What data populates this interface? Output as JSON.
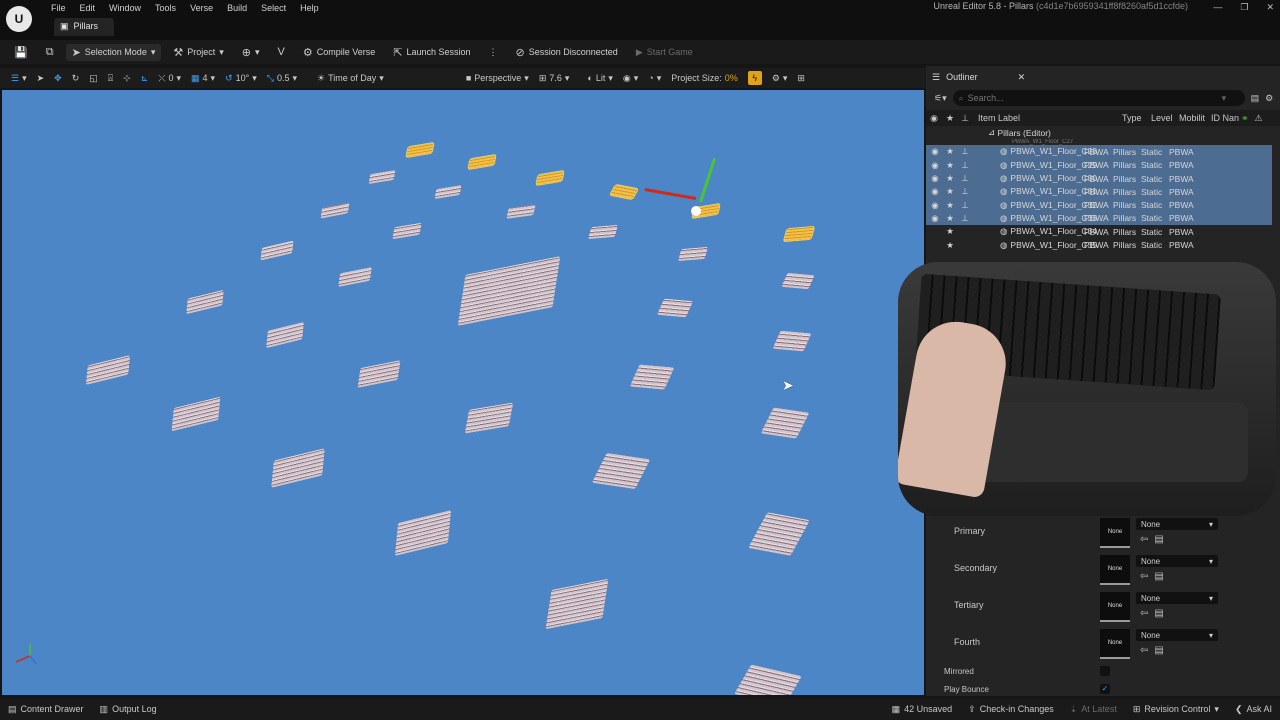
{
  "menu": [
    "File",
    "Edit",
    "Window",
    "Tools",
    "Verse",
    "Build",
    "Select",
    "Help"
  ],
  "level_tab": "Pillars",
  "app_title": "Unreal Editor 5.8 - Pillars",
  "app_hash": "(c4d1e7b6959341ff8f8260af5d1ccfde)",
  "toolbar": {
    "selection_mode": "Selection Mode",
    "project": "Project",
    "compile_verse": "Compile Verse",
    "launch_session": "Launch Session",
    "session_status": "Session Disconnected",
    "start_game": "Start Game"
  },
  "viewport_toolbar": {
    "count_a": "0",
    "count_b": "4",
    "angle_snap": "10°",
    "scale_snap": "0.5",
    "time_of_day": "Time of Day",
    "perspective": "Perspective",
    "fov": "7.6",
    "lit": "Lit",
    "project_size_label": "Project Size:",
    "project_size_value": "0%"
  },
  "outliner": {
    "tab": "Outliner",
    "search_placeholder": "Search...",
    "columns": {
      "label": "Item Label",
      "type": "Type",
      "level": "Level",
      "mobility": "Mobilit",
      "id": "ID Nan"
    },
    "root": "Pillars (Editor)",
    "partial_top": "PBWA_W1_Floor_C27",
    "rows": [
      {
        "label": "PBWA_W1_Floor_C28",
        "type": "PBWA",
        "level": "Pillars",
        "mobility": "Static",
        "id": "PBWA",
        "selected": true
      },
      {
        "label": "PBWA_W1_Floor_C29",
        "type": "PBWA",
        "level": "Pillars",
        "mobility": "Static",
        "id": "PBWA",
        "selected": true
      },
      {
        "label": "PBWA_W1_Floor_C30",
        "type": "PBWA",
        "level": "Pillars",
        "mobility": "Static",
        "id": "PBWA",
        "selected": true
      },
      {
        "label": "PBWA_W1_Floor_C31",
        "type": "PBWA",
        "level": "Pillars",
        "mobility": "Static",
        "id": "PBWA",
        "selected": true
      },
      {
        "label": "PBWA_W1_Floor_C32",
        "type": "PBWA",
        "level": "Pillars",
        "mobility": "Static",
        "id": "PBWA",
        "selected": true
      },
      {
        "label": "PBWA_W1_Floor_C33",
        "type": "PBWA",
        "level": "Pillars",
        "mobility": "Static",
        "id": "PBWA",
        "selected": true
      },
      {
        "label": "PBWA_W1_Floor_C34",
        "type": "PBWA",
        "level": "Pillars",
        "mobility": "Static",
        "id": "PBWA",
        "selected": false
      },
      {
        "label": "PBWA_W1_Floor_C35",
        "type": "PBWA",
        "level": "Pillars",
        "mobility": "Static",
        "id": "PBWA",
        "selected": false
      }
    ]
  },
  "details": {
    "slots": [
      {
        "label": "Primary",
        "thumb": "None",
        "value": "None"
      },
      {
        "label": "Secondary",
        "thumb": "None",
        "value": "None"
      },
      {
        "label": "Tertiary",
        "thumb": "None",
        "value": "None"
      },
      {
        "label": "Fourth",
        "thumb": "None",
        "value": "None"
      }
    ],
    "mirrored_label": "Mirrored",
    "mirrored": false,
    "play_bounce_label": "Play Bounce",
    "play_bounce": true
  },
  "statusbar": {
    "content_drawer": "Content Drawer",
    "output_log": "Output Log",
    "unsaved": "42 Unsaved",
    "checkin": "Check-in Changes",
    "at_latest": "At Latest",
    "revision_control": "Revision Control",
    "ask_ai": "Ask AI"
  },
  "icons": {
    "save": "floppy-icon",
    "gizmo_x_color": "#d12a1d",
    "gizmo_y_color": "#46c537",
    "selected_tile_color": "#f1c247",
    "viewport_bg": "#4c86c6"
  }
}
